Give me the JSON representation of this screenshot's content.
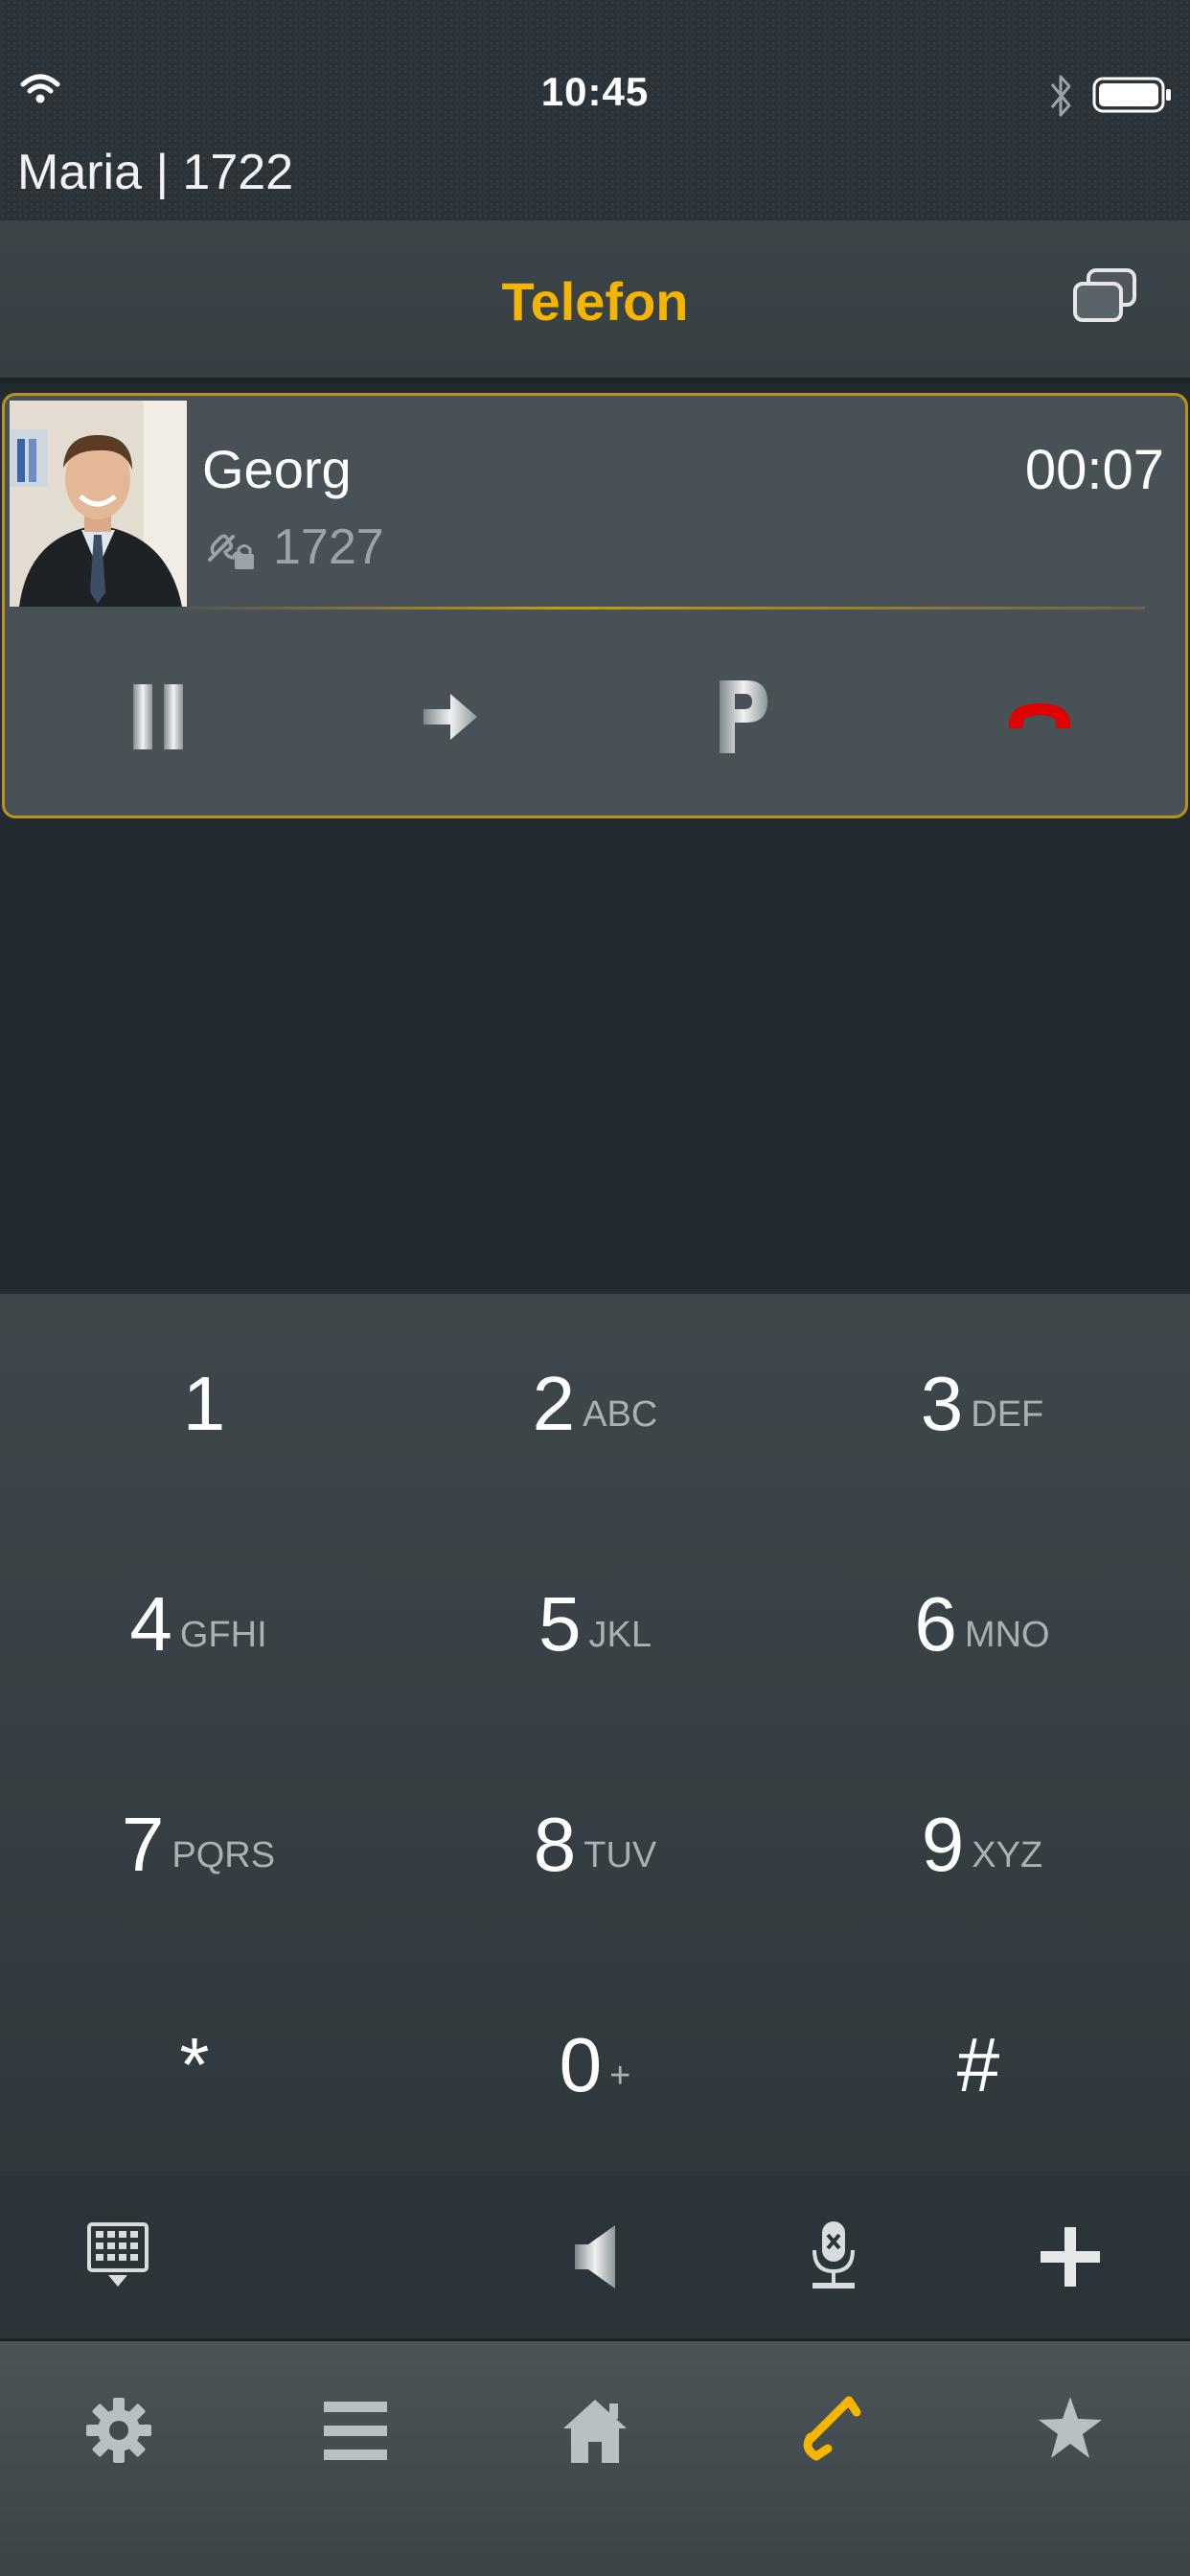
{
  "status_bar": {
    "time": "10:45",
    "user": "Maria | 1722"
  },
  "header": {
    "title": "Telefon"
  },
  "call": {
    "name": "Georg",
    "number": "1727",
    "duration": "00:07",
    "actions": [
      {
        "name": "hold",
        "icon": "pause-icon"
      },
      {
        "name": "transfer",
        "icon": "arrow-right-icon"
      },
      {
        "name": "park",
        "icon": "park-icon",
        "label": "P"
      },
      {
        "name": "hangup",
        "icon": "hangup-icon",
        "color": "#e00000"
      }
    ]
  },
  "keypad": [
    {
      "digit": "1",
      "letters": ""
    },
    {
      "digit": "2",
      "letters": "ABC"
    },
    {
      "digit": "3",
      "letters": "DEF"
    },
    {
      "digit": "4",
      "letters": "GFHI"
    },
    {
      "digit": "5",
      "letters": "JKL"
    },
    {
      "digit": "6",
      "letters": "MNO"
    },
    {
      "digit": "7",
      "letters": "PQRS"
    },
    {
      "digit": "8",
      "letters": "TUV"
    },
    {
      "digit": "9",
      "letters": "XYZ"
    },
    {
      "digit": "*",
      "letters": ""
    },
    {
      "digit": "0",
      "letters": "+"
    },
    {
      "digit": "#",
      "letters": ""
    }
  ],
  "toolbar": [
    "keypad-toggle-icon",
    "speaker-icon",
    "mute-mic-icon",
    "add-call-icon"
  ],
  "tabbar": {
    "items": [
      "settings-icon",
      "menu-icon",
      "home-icon",
      "phone-icon",
      "favorites-icon"
    ],
    "active": "phone-icon",
    "accent": "#f4b400"
  },
  "colors": {
    "accent": "#f4b400",
    "hangup": "#e00000",
    "card_border": "#b8911f"
  }
}
